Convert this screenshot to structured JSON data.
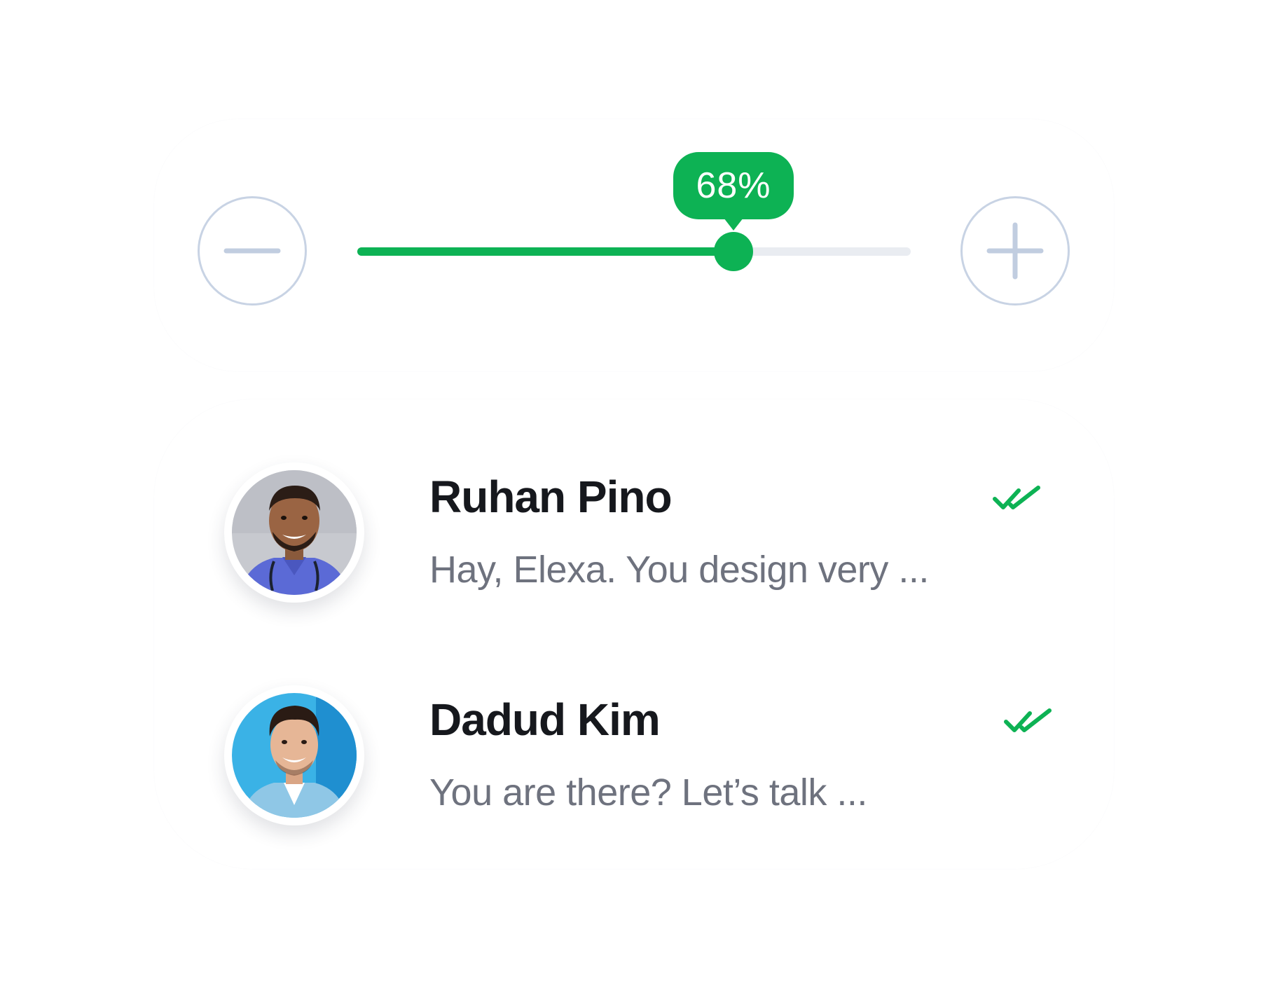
{
  "slider": {
    "value_percent": 68,
    "value_label": "68%",
    "decrease_icon": "minus-icon",
    "increase_icon": "plus-icon",
    "accent_color": "#0db254",
    "track_color": "#e9ecf1",
    "button_border_color": "#c8d3e4"
  },
  "chats": [
    {
      "name": "Ruhan Pino",
      "preview": "Hay, Elexa. You design very ...",
      "status_icon": "double-check-icon",
      "status_color": "#0db254"
    },
    {
      "name": "Dadud Kim",
      "preview": "You are there? Let’s talk ...",
      "status_icon": "double-check-icon",
      "status_color": "#0db254"
    }
  ]
}
